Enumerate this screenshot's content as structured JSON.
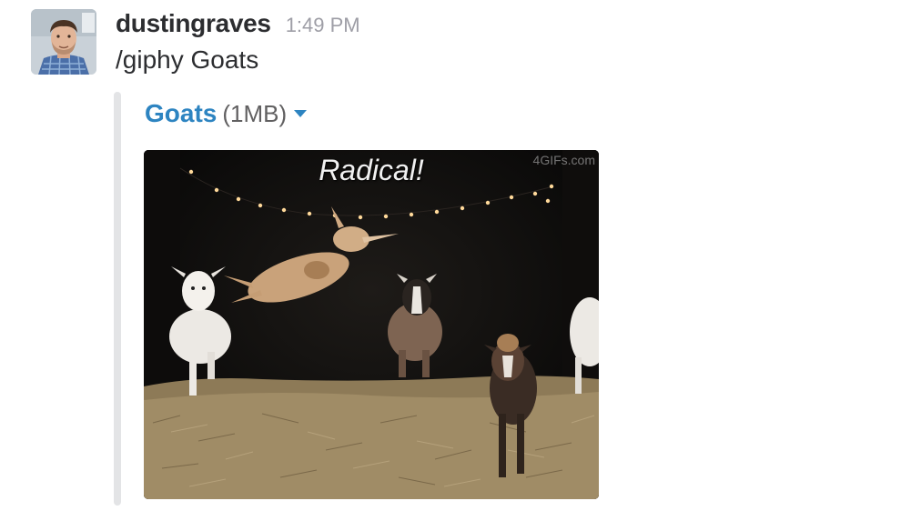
{
  "message": {
    "username": "dustingraves",
    "timestamp": "1:49 PM",
    "text": "/giphy Goats"
  },
  "attachment": {
    "title": "Goats",
    "size": "(1MB)",
    "image": {
      "caption": "Radical!",
      "watermark": "4GIFs.com",
      "alt": "Goats"
    }
  },
  "colors": {
    "link": "#2d84c1",
    "username": "#2c2d30",
    "timestamp": "#9e9ea6",
    "attachment_bar": "#e3e4e6"
  },
  "icons": {
    "file_menu": "caret-down-icon"
  }
}
